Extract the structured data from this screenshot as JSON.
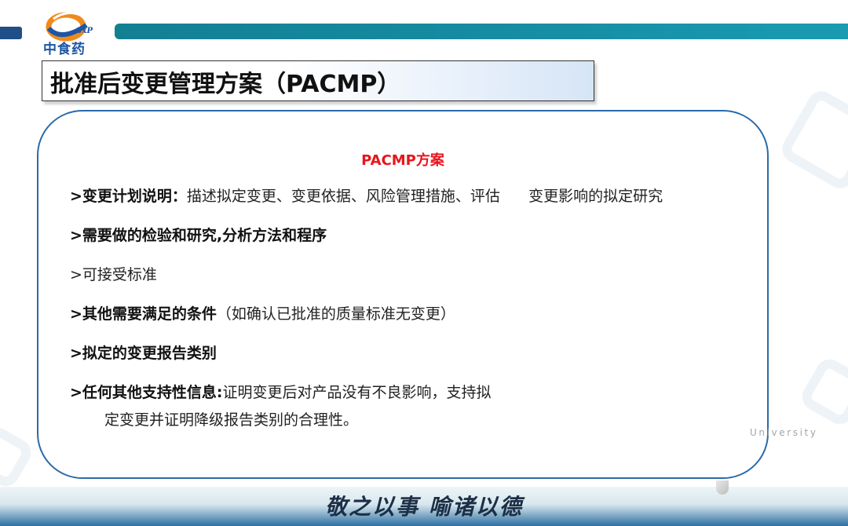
{
  "logo": {
    "name": "中食药",
    "mark": "GxP"
  },
  "title": "批准后变更管理方案（PACMP）",
  "card": {
    "heading": "PACMP方案",
    "items": [
      {
        "bold": ">变更计划说明：",
        "rest": "描述拟定变更、变更依据、风险管理措施、评估      变更影响的拟定研究"
      },
      {
        "bold": ">需要做的检验和研究,分析方法和程序",
        "rest": ""
      },
      {
        "bold": "",
        "rest": ">可接受标准"
      },
      {
        "bold": ">其他需要满足的条件",
        "rest": "（如确认已批准的质量标准无变更）"
      },
      {
        "bold": ">拟定的变更报告类别",
        "rest": ""
      },
      {
        "bold": ">任何其他支持性信息:",
        "rest": "证明变更后对产品没有不良影响，支持拟"
      }
    ],
    "continuation": "定变更并证明降级报告类别的合理性。"
  },
  "watermark": "University",
  "motto": "敬之以事  喻诸以德",
  "colors": {
    "teal_bar": "#168ea4",
    "navy_bar": "#1f4f86",
    "card_border": "#2b6aa8",
    "heading_red": "#e8141c"
  }
}
